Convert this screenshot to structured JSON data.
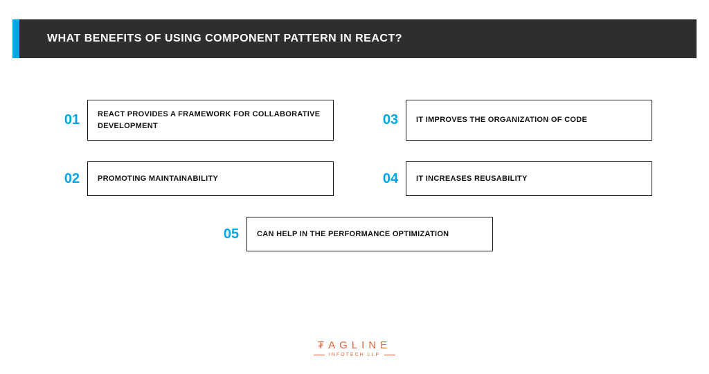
{
  "header": {
    "title": "WHAT BENEFITS OF USING COMPONENT PATTERN IN REACT?"
  },
  "items": [
    {
      "num": "01",
      "text": "REACT PROVIDES A FRAMEWORK FOR COLLABORATIVE DEVELOPMENT"
    },
    {
      "num": "03",
      "text": "IT IMPROVES THE ORGANIZATION OF CODE"
    },
    {
      "num": "02",
      "text": "PROMOTING MAINTAINABILITY"
    },
    {
      "num": "04",
      "text": "IT INCREASES REUSABILITY"
    },
    {
      "num": "05",
      "text": "CAN HELP IN THE PERFORMANCE OPTIMIZATION"
    }
  ],
  "logo": {
    "main": "₮AGLINE",
    "sub": "INFOTECH LLP"
  }
}
